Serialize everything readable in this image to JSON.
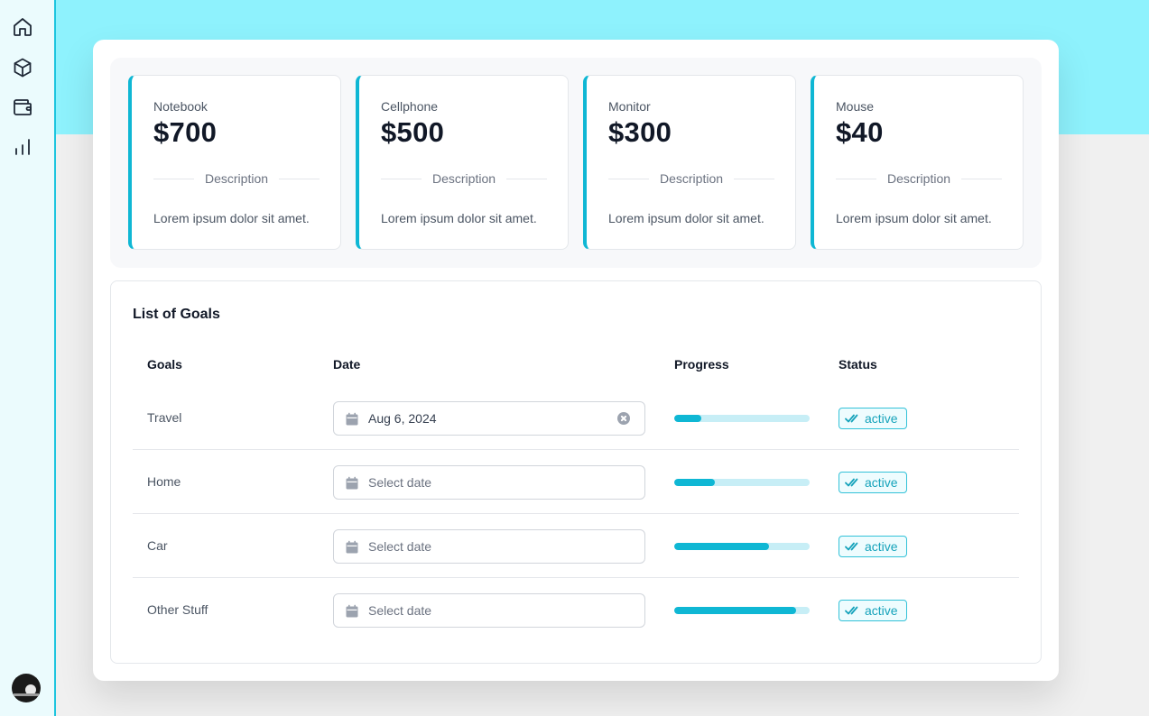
{
  "colors": {
    "accent": "#0fb7d4",
    "top_band": "#8ef2fd",
    "sidebar_bg": "#ebfbfd",
    "progress_track": "#c7eef6"
  },
  "sidebar": {
    "items": [
      {
        "icon": "home-icon"
      },
      {
        "icon": "box-icon"
      },
      {
        "icon": "wallet-icon"
      },
      {
        "icon": "bar-chart-icon"
      }
    ],
    "avatar": "user-avatar"
  },
  "stats": [
    {
      "label": "Notebook",
      "value": "$700",
      "divider_label": "Description",
      "description": "Lorem ipsum dolor sit amet."
    },
    {
      "label": "Cellphone",
      "value": "$500",
      "divider_label": "Description",
      "description": "Lorem ipsum dolor sit amet."
    },
    {
      "label": "Monitor",
      "value": "$300",
      "divider_label": "Description",
      "description": "Lorem ipsum dolor sit amet."
    },
    {
      "label": "Mouse",
      "value": "$40",
      "divider_label": "Description",
      "description": "Lorem ipsum dolor sit amet."
    }
  ],
  "goals": {
    "title": "List of Goals",
    "columns": {
      "goals": "Goals",
      "date": "Date",
      "progress": "Progress",
      "status": "Status"
    },
    "rows": [
      {
        "name": "Travel",
        "date": "Aug 6, 2024",
        "date_placeholder": "",
        "progress": 0.2,
        "status": "active"
      },
      {
        "name": "Home",
        "date": "",
        "date_placeholder": "Select date",
        "progress": 0.3,
        "status": "active"
      },
      {
        "name": "Car",
        "date": "",
        "date_placeholder": "Select date",
        "progress": 0.7,
        "status": "active"
      },
      {
        "name": "Other Stuff",
        "date": "",
        "date_placeholder": "Select date",
        "progress": 0.9,
        "status": "active"
      }
    ]
  }
}
